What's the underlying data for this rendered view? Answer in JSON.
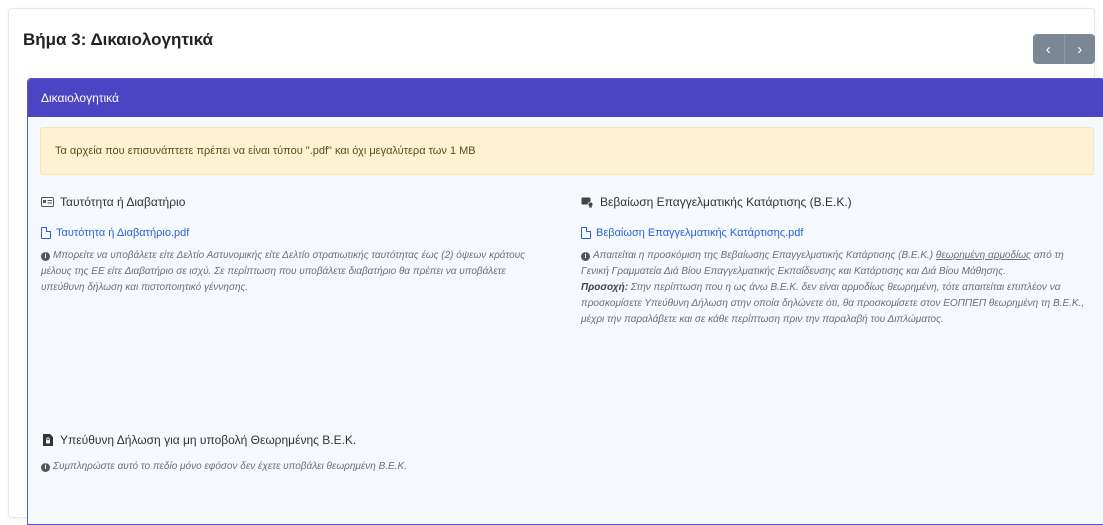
{
  "page": {
    "title": "Βήμα 3: Δικαιολογητικά",
    "nav": {
      "prev": "‹",
      "next": "›"
    }
  },
  "panel": {
    "header": "Δικαιολογητικά",
    "alert": "Τα αρχεία που επισυνάπτετε πρέπει να είναι τύπου \".pdf\" και όχι μεγαλύτερα των 1 MB"
  },
  "docs": {
    "id": {
      "icon": "id-card-icon",
      "title": "Ταυτότητα ή Διαβατήριο",
      "file": "Ταυτότητα ή Διαβατήριο.pdf",
      "help": "Μπορείτε να υποβάλετε είτε Δελτίο Αστυνομικής είτε Δελτίο στρατιωτικής ταυτότητας έως (2) όψεων κράτους μέλους της ΕΕ είτε Διαβατήριο σε ισχύ. Σε περίπτωση που υποβάλετε διαβατήριο θα πρέπει να υποβάλετε υπεύθυνη δήλωση και πιστοποιητικό γέννησης."
    },
    "vek": {
      "icon": "certificate-icon",
      "title": "Βεβαίωση Επαγγελματικής Κατάρτισης (Β.Ε.Κ.)",
      "file": "Βεβαίωση Επαγγελματικής Κατάρτισης.pdf",
      "help_a": "Απαιτείται η προσκόμιση της Βεβαίωσης Επαγγελματικής Κατάρτισης (Β.Ε.Κ.) ",
      "help_u": "θεωρημένη αρμοδίως",
      "help_b": " από τη Γενική Γραμματεία Διά Βίου Επαγγελματικής Εκπαίδευσης και Κατάρτισης και Διά Βίου Μάθησης.",
      "warn_label": "Προσοχή:",
      "warn_text": " Στην περίπτωση που η ως άνω Β.Ε.Κ. δεν είναι αρμοδίως θεωρημένη, τότε απαιτείται επιπλέον να προσκομίσετε Υπεύθυνη Δήλωση στην οποία δηλώνετε ότι, θα προσκομίσετε στον ΕΟΠΠΕΠ θεωρημένη τη Β.Ε.Κ., μέχρι την παραλάβετε και σε κάθε περίπτωση πριν την παραλαβή του Διπλώματος."
    },
    "decl": {
      "icon": "file-lock-icon",
      "title": "Υπεύθυνη Δήλωση για μη υποβολή Θεωρημένης Β.Ε.Κ.",
      "help": "Συμπληρώστε αυτό το πεδίο μόνο εφόσον δεν έχετε υποβάλει θεωρημένη Β.Ε.Κ."
    }
  }
}
